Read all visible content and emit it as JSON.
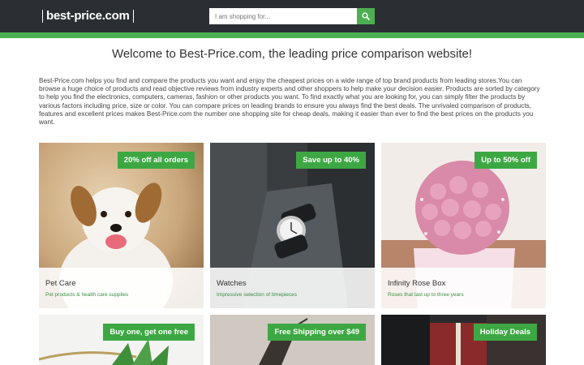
{
  "header": {
    "logo_text": "best-price.com",
    "search_placeholder": "I am shopping for...",
    "search_icon": "search-icon",
    "accent_color": "#4caf50",
    "dark_color": "#2b2f33"
  },
  "main": {
    "heading": "Welcome to Best-Price.com, the leading price comparison website!",
    "intro": "Best-Price.com helps you find and compare the products you want and enjoy the cheapest prices on a wide range of top brand products from leading stores.You can browse a huge choice of products and read objective reviews from industry experts and other shoppers to help make your decision easier. Products are sorted by category to help you find the electronics, computers, cameras, fashion or other products you want. To find exactly what you are looking for, you can simply filter the products by various factors including price, size or color. You can compare prices on leading brands to ensure you always find the best deals. The unrivaled comparison of products, features and excellent prices makes Best-Price.com the number one shopping site for cheap deals, making it easier than ever to find the best prices on the products you want."
  },
  "cards": [
    {
      "badge": "20% off all orders",
      "title": "Pet Care",
      "subtitle": "Pet products & health care supplies"
    },
    {
      "badge": "Save up to 40%",
      "title": "Watches",
      "subtitle": "Impressive selection of timepieces"
    },
    {
      "badge": "Up to 50% off",
      "title": "Infinity Rose Box",
      "subtitle": "Roses that last up to three years"
    },
    {
      "badge": "Buy one, get one free",
      "title": "",
      "subtitle": ""
    },
    {
      "badge": "Free Shipping over $49",
      "title": "",
      "subtitle": ""
    },
    {
      "badge": "Holiday Deals",
      "title": "",
      "subtitle": ""
    }
  ]
}
